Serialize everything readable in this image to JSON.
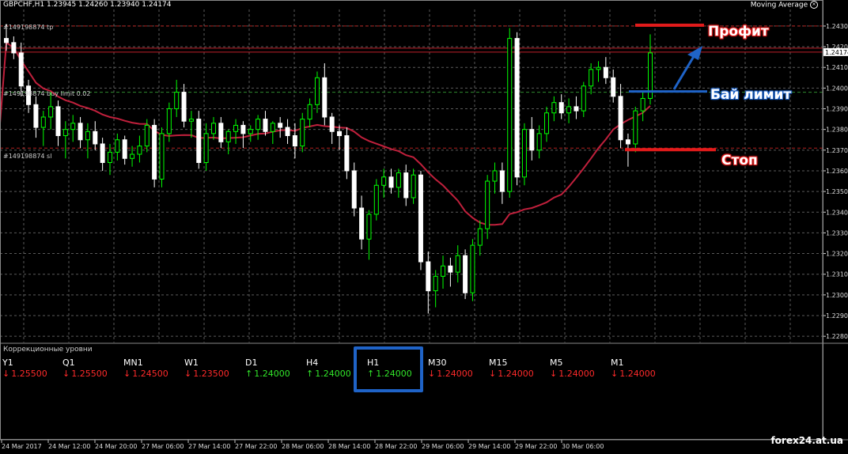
{
  "header": {
    "symbol_info": "GBPCHF,H1  1.23945 1.24260 1.23940 1.24174",
    "indicator": "Moving Average",
    "indicator_icon": "close-circle-icon"
  },
  "order_lines": {
    "tp_label": "#149198874 tp",
    "buy_limit_label": "#149198874 buy limit 0.02",
    "sl_label": "#149198874 sl"
  },
  "annotations": {
    "profit": "Профит",
    "buy_limit": "Бай лимит",
    "stop": "Стоп"
  },
  "subwindow": {
    "title": "Коррекционные уровни",
    "levels": [
      {
        "tf": "Y1",
        "dir": "down",
        "value": "1.25500"
      },
      {
        "tf": "Q1",
        "dir": "down",
        "value": "1.25500"
      },
      {
        "tf": "MN1",
        "dir": "down",
        "value": "1.24500"
      },
      {
        "tf": "W1",
        "dir": "down",
        "value": "1.23500"
      },
      {
        "tf": "D1",
        "dir": "up",
        "value": "1.24000"
      },
      {
        "tf": "H4",
        "dir": "up",
        "value": "1.24000"
      },
      {
        "tf": "H1",
        "dir": "up",
        "value": "1.24000"
      },
      {
        "tf": "M30",
        "dir": "down",
        "value": "1.24000"
      },
      {
        "tf": "M15",
        "dir": "down",
        "value": "1.24000"
      },
      {
        "tf": "M5",
        "dir": "down",
        "value": "1.24000"
      },
      {
        "tf": "M1",
        "dir": "down",
        "value": "1.24000"
      }
    ],
    "highlighted_tf": "H1"
  },
  "watermark": "forex24.at.ua",
  "colors": {
    "bull": "#00ff00",
    "bear": "#ffffff",
    "ma": "#c0203c",
    "grid": "#5a5a5a",
    "price_line": "#c0202a",
    "order_line": "#2f8a2f",
    "accent_red": "#e21b1b",
    "accent_blue": "#1f63c7"
  },
  "chart_data": {
    "type": "candlestick",
    "symbol": "GBPCHF",
    "timeframe": "H1",
    "y_ticks": [
      "1.2430",
      "1.2420",
      "1.2410",
      "1.2400",
      "1.2390",
      "1.2380",
      "1.2370",
      "1.2360",
      "1.2350",
      "1.2340",
      "1.2330",
      "1.2320",
      "1.2310",
      "1.2300",
      "1.2290",
      "1.2280"
    ],
    "ylim": [
      1.2277,
      1.2438
    ],
    "current_price": "1.24174",
    "levels": {
      "tp": 1.243,
      "buy_limit": 1.2398,
      "sl": 1.2371
    },
    "x_labels": [
      "24 Mar 2017",
      "24 Mar 12:00",
      "24 Mar 20:00",
      "27 Mar 06:00",
      "27 Mar 14:00",
      "27 Mar 22:00",
      "28 Mar 06:00",
      "28 Mar 14:00",
      "28 Mar 22:00",
      "29 Mar 06:00",
      "29 Mar 14:00",
      "29 Mar 22:00",
      "30 Mar 06:00"
    ],
    "ohlc": [
      [
        1.2424,
        1.2431,
        1.2418,
        1.2422
      ],
      [
        1.2422,
        1.2425,
        1.2414,
        1.2417
      ],
      [
        1.2417,
        1.2422,
        1.2396,
        1.2401
      ],
      [
        1.2401,
        1.2404,
        1.2388,
        1.2392
      ],
      [
        1.2392,
        1.2396,
        1.2376,
        1.2381
      ],
      [
        1.2381,
        1.2389,
        1.2372,
        1.2386
      ],
      [
        1.2386,
        1.2398,
        1.238,
        1.2391
      ],
      [
        1.2391,
        1.2394,
        1.2372,
        1.2377
      ],
      [
        1.2377,
        1.2384,
        1.2366,
        1.238
      ],
      [
        1.238,
        1.2387,
        1.2374,
        1.2383
      ],
      [
        1.2383,
        1.2386,
        1.2371,
        1.2375
      ],
      [
        1.2375,
        1.2383,
        1.2366,
        1.2379
      ],
      [
        1.2379,
        1.2384,
        1.237,
        1.2373
      ],
      [
        1.2373,
        1.2376,
        1.236,
        1.2364
      ],
      [
        1.2364,
        1.2373,
        1.2358,
        1.2369
      ],
      [
        1.2369,
        1.2378,
        1.2365,
        1.2375
      ],
      [
        1.2375,
        1.2377,
        1.2363,
        1.2366
      ],
      [
        1.2366,
        1.2372,
        1.2362,
        1.2368
      ],
      [
        1.2368,
        1.2377,
        1.2364,
        1.2372
      ],
      [
        1.2372,
        1.2385,
        1.2369,
        1.2382
      ],
      [
        1.2382,
        1.2385,
        1.2352,
        1.2356
      ],
      [
        1.2356,
        1.2381,
        1.2352,
        1.2378
      ],
      [
        1.2378,
        1.2393,
        1.2374,
        1.239
      ],
      [
        1.239,
        1.2404,
        1.2386,
        1.2398
      ],
      [
        1.2398,
        1.2402,
        1.2381,
        1.2384
      ],
      [
        1.2384,
        1.2389,
        1.2376,
        1.2385
      ],
      [
        1.2385,
        1.2389,
        1.2361,
        1.2364
      ],
      [
        1.2364,
        1.2383,
        1.236,
        1.2378
      ],
      [
        1.2378,
        1.2386,
        1.2375,
        1.2383
      ],
      [
        1.2383,
        1.2386,
        1.2371,
        1.2374
      ],
      [
        1.2374,
        1.238,
        1.2368,
        1.2379
      ],
      [
        1.2379,
        1.2385,
        1.2373,
        1.2382
      ],
      [
        1.2382,
        1.2384,
        1.2371,
        1.2378
      ],
      [
        1.2378,
        1.2382,
        1.2374,
        1.238
      ],
      [
        1.238,
        1.2387,
        1.2375,
        1.2385
      ],
      [
        1.2385,
        1.2389,
        1.2377,
        1.2379
      ],
      [
        1.2379,
        1.2384,
        1.2373,
        1.2383
      ],
      [
        1.2383,
        1.2386,
        1.2376,
        1.2381
      ],
      [
        1.2381,
        1.2385,
        1.2373,
        1.2377
      ],
      [
        1.2377,
        1.2383,
        1.2366,
        1.2372
      ],
      [
        1.2372,
        1.2388,
        1.2369,
        1.2385
      ],
      [
        1.2385,
        1.2395,
        1.2381,
        1.2392
      ],
      [
        1.2392,
        1.2408,
        1.2388,
        1.2405
      ],
      [
        1.2405,
        1.2412,
        1.2382,
        1.2386
      ],
      [
        1.2386,
        1.2388,
        1.2373,
        1.2379
      ],
      [
        1.2379,
        1.2382,
        1.237,
        1.2377
      ],
      [
        1.2377,
        1.2381,
        1.2356,
        1.236
      ],
      [
        1.236,
        1.2364,
        1.2338,
        1.2342
      ],
      [
        1.2342,
        1.2348,
        1.2322,
        1.2327
      ],
      [
        1.2327,
        1.2341,
        1.2317,
        1.2339
      ],
      [
        1.2339,
        1.2356,
        1.2336,
        1.2353
      ],
      [
        1.2353,
        1.2361,
        1.2347,
        1.2357
      ],
      [
        1.2357,
        1.2361,
        1.2349,
        1.2352
      ],
      [
        1.2352,
        1.2361,
        1.2347,
        1.2359
      ],
      [
        1.2359,
        1.2363,
        1.2343,
        1.2347
      ],
      [
        1.2347,
        1.2361,
        1.2344,
        1.2358
      ],
      [
        1.2358,
        1.236,
        1.2312,
        1.2316
      ],
      [
        1.2316,
        1.2321,
        1.2291,
        1.2302
      ],
      [
        1.2302,
        1.2312,
        1.2294,
        1.2309
      ],
      [
        1.2309,
        1.2319,
        1.2303,
        1.2314
      ],
      [
        1.2314,
        1.2318,
        1.2304,
        1.2311
      ],
      [
        1.2311,
        1.2324,
        1.2306,
        1.2319
      ],
      [
        1.2319,
        1.2322,
        1.2298,
        1.2301
      ],
      [
        1.2301,
        1.2327,
        1.2297,
        1.2324
      ],
      [
        1.2324,
        1.2336,
        1.2319,
        1.2332
      ],
      [
        1.2332,
        1.2358,
        1.2327,
        1.2355
      ],
      [
        1.2355,
        1.2364,
        1.2349,
        1.236
      ],
      [
        1.236,
        1.2364,
        1.2344,
        1.235
      ],
      [
        1.235,
        1.2429,
        1.2347,
        1.2424
      ],
      [
        1.2424,
        1.2427,
        1.2353,
        1.2357
      ],
      [
        1.2357,
        1.2383,
        1.2353,
        1.238
      ],
      [
        1.238,
        1.2386,
        1.2365,
        1.237
      ],
      [
        1.237,
        1.2382,
        1.2366,
        1.2378
      ],
      [
        1.2378,
        1.2391,
        1.2374,
        1.2388
      ],
      [
        1.2388,
        1.2396,
        1.2384,
        1.2393
      ],
      [
        1.2393,
        1.2397,
        1.2385,
        1.2388
      ],
      [
        1.2388,
        1.2395,
        1.2383,
        1.2391
      ],
      [
        1.2391,
        1.2396,
        1.2385,
        1.2389
      ],
      [
        1.2389,
        1.2403,
        1.2386,
        1.2401
      ],
      [
        1.2401,
        1.2412,
        1.2397,
        1.2409
      ],
      [
        1.2409,
        1.2413,
        1.2403,
        1.241
      ],
      [
        1.241,
        1.2415,
        1.2402,
        1.2405
      ],
      [
        1.2405,
        1.2409,
        1.2393,
        1.2396
      ],
      [
        1.2396,
        1.2402,
        1.2371,
        1.2375
      ],
      [
        1.2375,
        1.2378,
        1.2362,
        1.2373
      ],
      [
        1.2373,
        1.2391,
        1.2369,
        1.2389
      ],
      [
        1.2389,
        1.2398,
        1.2384,
        1.2395
      ],
      [
        1.2395,
        1.2426,
        1.2392,
        1.2417
      ]
    ]
  }
}
